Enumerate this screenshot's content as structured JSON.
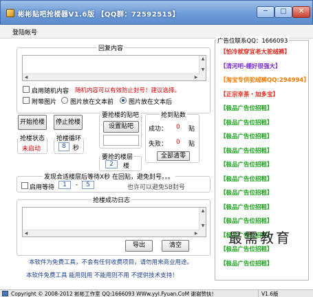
{
  "window": {
    "title": "彬彬贴吧抢楼器V1.6版 【QQ群：72592515】",
    "minimize_glyph": "─",
    "maximize_glyph": "□",
    "close_glyph": "✕"
  },
  "menu": {
    "items": [
      "登陆帐号"
    ]
  },
  "reply": {
    "group_title": "回复内容",
    "random_content_label": "启用随机内容",
    "random_content_warning": "随机内容可以有效防止封号！建议选择。",
    "attach_image_label": "附带图片",
    "image_before_label": "图片放在文本前",
    "image_after_label": "图片放在文本后"
  },
  "controls": {
    "start_button": "开始抢楼",
    "stop_button": "停止抢楼",
    "status_group_title": "抢楼状态",
    "status_value": "未启动",
    "cycle_group_title": "抢楼循环",
    "cycle_value": "8",
    "cycle_unit": "秒"
  },
  "target_bar": {
    "group_title": "要抢楼的贴吧",
    "set_bar_button": "设置贴吧",
    "floor_group_title": "要抢的楼层",
    "floor_value": "2",
    "floor_unit": "楼"
  },
  "stats": {
    "group_title": "抢到贴数",
    "success_label": "成功：",
    "success_value": "0",
    "success_unit": "贴",
    "fail_label": "失败：",
    "fail_value": "0",
    "fail_unit": "贴",
    "clear_button": "全部清零"
  },
  "wait": {
    "group_title": "发现合适楼层后等待X秒 在回贴，避免封号。。。",
    "enable_label": "启用等待",
    "from_value": "1",
    "separator": "-",
    "to_value": "5",
    "hint": "也许可以避免SB封号"
  },
  "log": {
    "group_title": "抢楼成功日志",
    "export_button": "导出",
    "clear_button": "清空"
  },
  "ads": {
    "title": "广告位联系QQ：1666093",
    "items": [
      {
        "text": "【怕冷就穿宜老大驼绒裤】",
        "color": "#e0261b"
      },
      {
        "text": "【清河吧-绷好很强大】",
        "color": "#7b2bd0"
      },
      {
        "text": "【淘宝专供驼绒裤QQ:294994】",
        "color": "#ff7a00"
      },
      {
        "text": "【正宗幸茶・加多宝】",
        "color": "#e0261b"
      },
      {
        "text": "【极品广告位招租】",
        "color": "#15a315"
      },
      {
        "text": "【极品广告位招租】",
        "color": "#15a315"
      },
      {
        "text": "【极品广告位招租】",
        "color": "#15a315"
      },
      {
        "text": "【极品广告位招租】",
        "color": "#15a315"
      },
      {
        "text": "【极品广告位招租】",
        "color": "#15a315"
      },
      {
        "text": "【极品广告位招租】",
        "color": "#15a315"
      },
      {
        "text": "【极品广告位招租】",
        "color": "#15a315"
      },
      {
        "text": "【极品广告位招租】",
        "color": "#15a315"
      },
      {
        "text": "【极品广告位招租】",
        "color": "#15a315"
      },
      {
        "text": "【极品广告位招租】",
        "color": "#15a315"
      },
      {
        "text": "【极品广告位招租】",
        "color": "#15a315"
      },
      {
        "text": "【极品广告位招租】",
        "color": "#15a315"
      }
    ]
  },
  "footer": {
    "line1": "本软件为免费工具，不会有任何收费项目，请勿用来商业用途。",
    "line2": "本软件免费工具 能用则用 不能用则不用 不提供技术支持！"
  },
  "watermark": "最需教育",
  "statusbar": {
    "text": "Copyright © 2008-2012 彬彬工作室 QQ:1666093 WWw.yyl.Fyuan.CoM 谢谢赞扶！",
    "version": "V1.6版"
  },
  "colors": {
    "title_bar": "#6f9bd6",
    "warning_red": "#e00000",
    "footer_blue": "#1c3f8f",
    "spin_blue": "#2451a1"
  }
}
